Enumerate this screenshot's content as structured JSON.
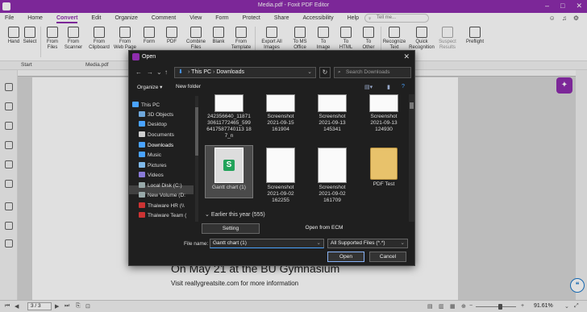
{
  "window": {
    "title": "Media.pdf - Foxit PDF Editor"
  },
  "menu": {
    "items": [
      "File",
      "Home",
      "Convert",
      "Edit",
      "Organize",
      "Comment",
      "View",
      "Form",
      "Protect",
      "Share",
      "Accessibility",
      "Help"
    ],
    "active": "Convert",
    "tellme_placeholder": "Tell me..."
  },
  "ribbon": {
    "tools": [
      {
        "label": "Hand",
        "label2": ""
      },
      {
        "label": "Select",
        "label2": ""
      },
      {
        "label": "From",
        "label2": "Files"
      },
      {
        "label": "From",
        "label2": "Scanner"
      },
      {
        "label": "From",
        "label2": "Clipboard"
      },
      {
        "label": "From",
        "label2": "Web Page"
      },
      {
        "label": "Form",
        "label2": ""
      },
      {
        "label": "PDF",
        "label2": ""
      },
      {
        "label": "Combine",
        "label2": "Files"
      },
      {
        "label": "Blank",
        "label2": ""
      },
      {
        "label": "From",
        "label2": "Template"
      },
      {
        "label": "Export All",
        "label2": "Images"
      },
      {
        "label": "To MS",
        "label2": "Office"
      },
      {
        "label": "To",
        "label2": "Image"
      },
      {
        "label": "To",
        "label2": "HTML"
      },
      {
        "label": "To",
        "label2": "Other"
      },
      {
        "label": "Recognize",
        "label2": "Text"
      },
      {
        "label": "Quick",
        "label2": "Recognition"
      },
      {
        "label": "Suspect",
        "label2": "Results"
      },
      {
        "label": "Preflight",
        "label2": ""
      }
    ]
  },
  "tabs": {
    "start": "Start",
    "doc": "Media.pdf"
  },
  "document": {
    "heading": "On May 21 at the BU Gymnasium",
    "subtext": "Visit reallygreatsite.com for more information"
  },
  "status": {
    "page": "3 / 3",
    "zoom": "91.61%"
  },
  "dialog": {
    "title": "Open",
    "close_glyph": "✕",
    "breadcrumb": [
      "This PC",
      "Downloads"
    ],
    "search_placeholder": "Search Downloads",
    "organize": "Organize",
    "new_folder": "New folder",
    "tree": [
      "This PC",
      "3D Objects",
      "Desktop",
      "Documents",
      "Downloads",
      "Music",
      "Pictures",
      "Videos",
      "Local Disk (C:)",
      "New Volume (D:",
      "Thaiware HR (\\\\",
      "Thaiware Team ("
    ],
    "tree_selected": "Downloads",
    "files_top": [
      {
        "line1": "242356640_11871",
        "line2": "30611772465_599",
        "line3": "6417587740113 18",
        "line4": "7_n"
      },
      {
        "line1": "Screenshot",
        "line2": "2021-09-15",
        "line3": "161904",
        "line4": ""
      },
      {
        "line1": "Screenshot",
        "line2": "2021-09-13",
        "line3": "145341",
        "line4": ""
      },
      {
        "line1": "Screenshot",
        "line2": "2021-09-13",
        "line3": "124930",
        "line4": ""
      }
    ],
    "files_mid": [
      {
        "line1": "Gantt chart (1)",
        "line2": "",
        "line3": ""
      },
      {
        "line1": "Screenshot",
        "line2": "2021-09-02",
        "line3": "162255"
      },
      {
        "line1": "Screenshot",
        "line2": "2021-09-02",
        "line3": "161709"
      },
      {
        "line1": "PDF Test",
        "line2": "",
        "line3": ""
      }
    ],
    "section": "Earlier this year (555)",
    "setting": "Setting",
    "open_from_ecm": "Open from ECM",
    "file_name_label": "File name:",
    "file_name": "Gantt chart (1)",
    "file_type": "All Supported Files (*.*)",
    "open": "Open",
    "cancel": "Cancel"
  },
  "colors": {
    "brand": "#8e2dad",
    "dialog_bg": "#1f1f1f",
    "excel_green": "#22a35a"
  }
}
